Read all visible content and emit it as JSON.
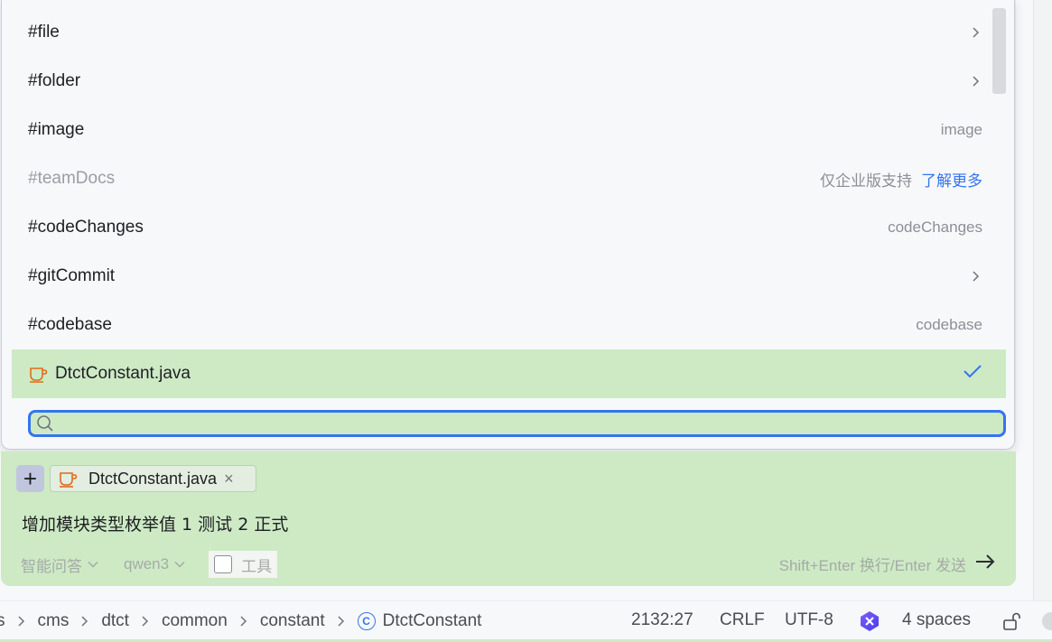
{
  "popup": {
    "items": [
      {
        "label": "#file",
        "trailing": "chevron"
      },
      {
        "label": "#folder",
        "trailing": "chevron"
      },
      {
        "label": "#image",
        "hint": "image"
      },
      {
        "label": "#teamDocs",
        "hint": "仅企业版支持",
        "link": "了解更多",
        "disabled": true
      },
      {
        "label": "#codeChanges",
        "hint": "codeChanges"
      },
      {
        "label": "#gitCommit",
        "trailing": "chevron"
      },
      {
        "label": "#codebase",
        "hint": "codebase"
      },
      {
        "label": "DtctConstant.java",
        "trailing": "check",
        "selected": true,
        "icon": "java-cup-icon"
      }
    ],
    "search": {
      "value": "",
      "placeholder": ""
    }
  },
  "chat": {
    "add_label": "+",
    "attachment": {
      "name": "DtctConstant.java",
      "close": "×"
    },
    "message": "增加模块类型枚举值 1 测试 2 正式",
    "mode": "智能问答",
    "model": "qwen3",
    "tools_label": "工具",
    "shortcut_hint": "Shift+Enter 换行/Enter 发送"
  },
  "statusbar": {
    "breadcrumbs": [
      "s",
      "cms",
      "dtct",
      "common",
      "constant",
      "DtctConstant"
    ],
    "class_icon": "C",
    "position": "2132:27",
    "line_ending": "CRLF",
    "encoding": "UTF-8",
    "indent": "4 spaces"
  },
  "colors": {
    "accent": "#3574f0",
    "selection": "#cdeac5",
    "java_icon": "#e06c1a"
  }
}
